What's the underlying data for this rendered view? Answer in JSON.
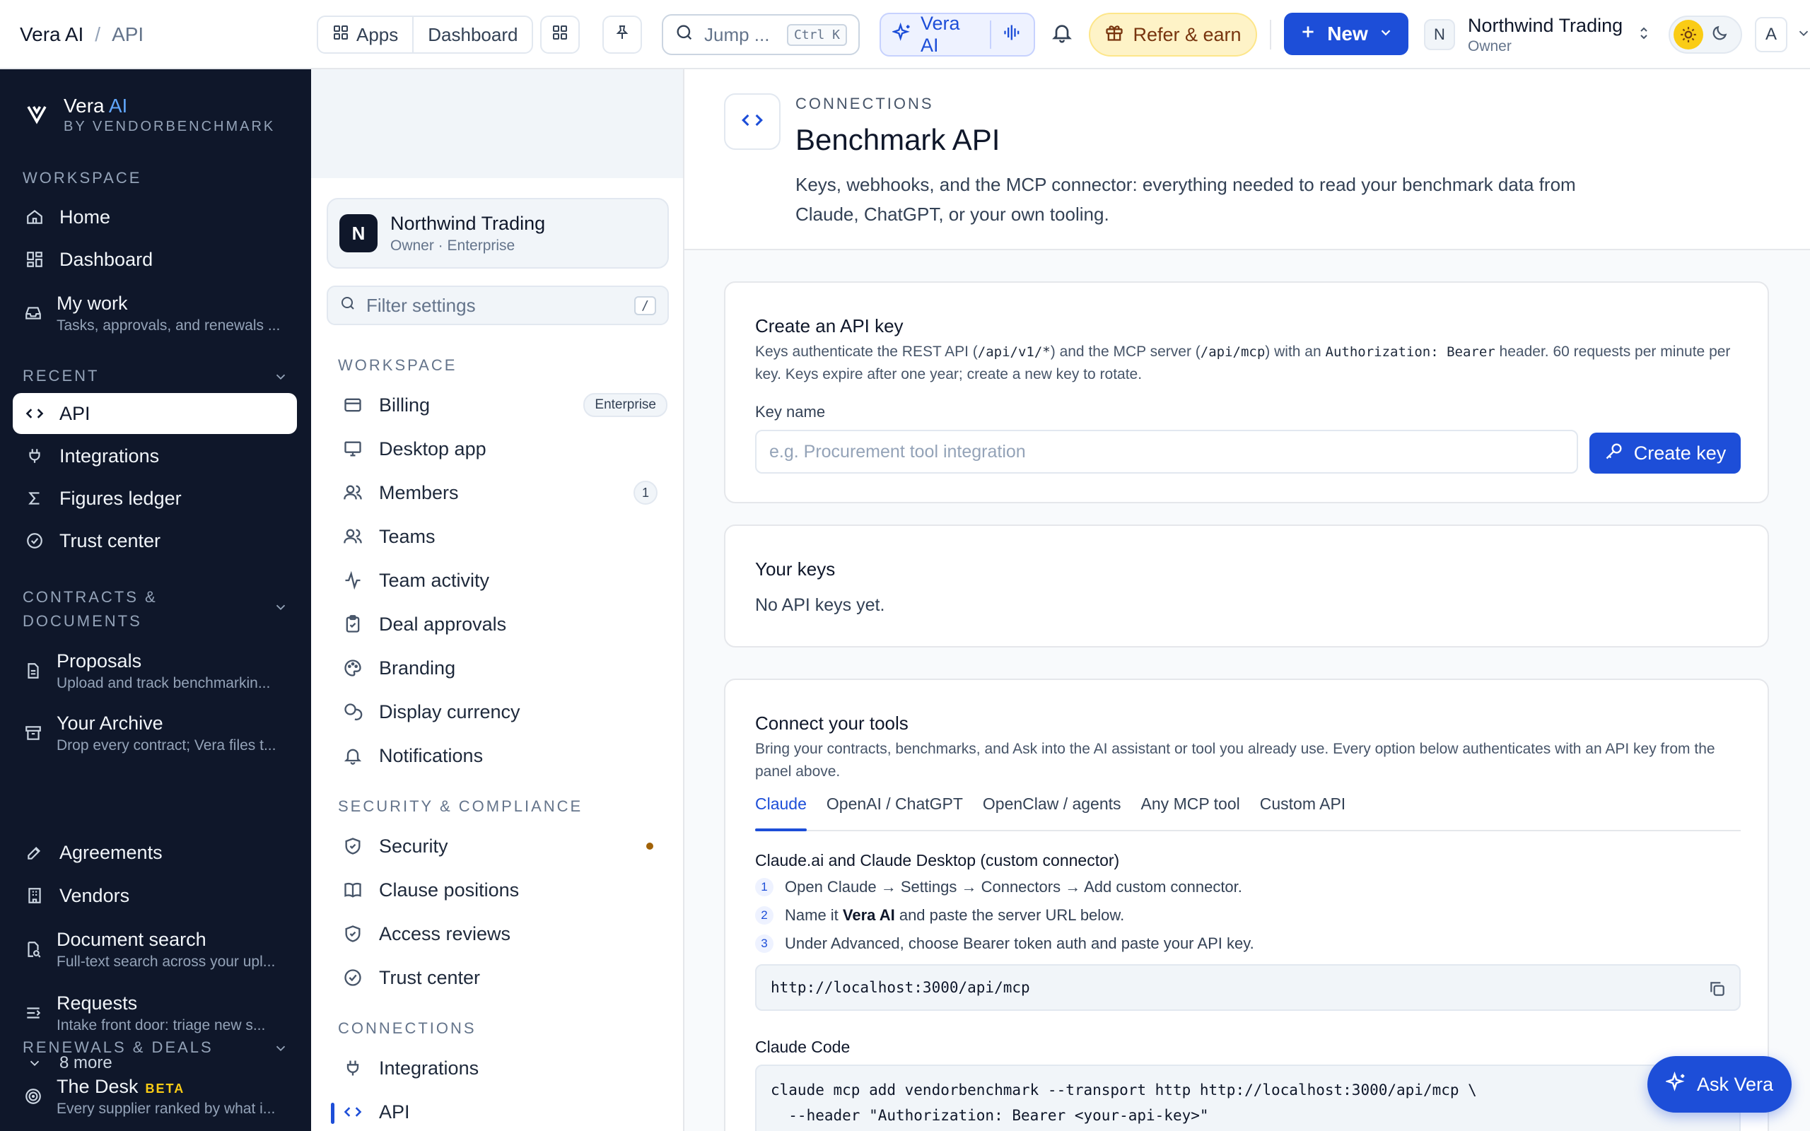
{
  "topbar": {
    "breadcrumb_root": "Vera AI",
    "breadcrumb_sep": "/",
    "breadcrumb_current": "API",
    "apps_label": "Apps",
    "dashboard_label": "Dashboard",
    "search_placeholder": "Jump ...",
    "search_shortcut": "Ctrl K",
    "vera_label": "Vera AI",
    "refer_label": "Refer & earn",
    "new_label": "New",
    "org_initial": "N",
    "org_name": "Northwind Trading",
    "org_role": "Owner",
    "user_initial": "A"
  },
  "sidebar": {
    "brand_name": "Vera",
    "brand_suffix": "AI",
    "brand_by": "BY VENDORBENCHMARK",
    "workspace_label": "WORKSPACE",
    "workspace_items": [
      {
        "label": "Home"
      },
      {
        "label": "Dashboard"
      },
      {
        "label": "My work",
        "sub": "Tasks, approvals, and renewals ..."
      }
    ],
    "recent_label": "RECENT",
    "recent_items": [
      {
        "label": "API"
      },
      {
        "label": "Integrations"
      },
      {
        "label": "Figures ledger"
      },
      {
        "label": "Trust center"
      }
    ],
    "contracts_label_1": "CONTRACTS &",
    "contracts_label_2": "DOCUMENTS",
    "contracts_items": [
      {
        "label": "Proposals",
        "sub": "Upload and track benchmarkin..."
      },
      {
        "label": "Your Archive",
        "sub": "Drop every contract; Vera files t..."
      },
      {
        "label": "Agreements"
      },
      {
        "label": "Vendors"
      },
      {
        "label": "Document search",
        "sub": "Full-text search across your upl..."
      },
      {
        "label": "Requests",
        "sub": "Intake front door: triage new s..."
      }
    ],
    "more_label": "8 more",
    "renewals_label": "RENEWALS & DEALS",
    "desk_label": "The Desk",
    "desk_badge": "BETA",
    "desk_sub": "Every supplier ranked by what i..."
  },
  "settings": {
    "org_initial": "N",
    "org_name": "Northwind Trading",
    "org_meta": "Owner · Enterprise",
    "filter_placeholder": "Filter settings",
    "filter_shortcut": "/",
    "workspace_label": "WORKSPACE",
    "workspace_items": [
      {
        "label": "Billing",
        "badge": "Enterprise"
      },
      {
        "label": "Desktop app"
      },
      {
        "label": "Members",
        "count": "1"
      },
      {
        "label": "Teams"
      },
      {
        "label": "Team activity"
      },
      {
        "label": "Deal approvals"
      },
      {
        "label": "Branding"
      },
      {
        "label": "Display currency"
      },
      {
        "label": "Notifications"
      }
    ],
    "security_label": "SECURITY & COMPLIANCE",
    "security_items": [
      {
        "label": "Security"
      },
      {
        "label": "Clause positions"
      },
      {
        "label": "Access reviews"
      },
      {
        "label": "Trust center"
      }
    ],
    "connections_label": "CONNECTIONS",
    "connections_items": [
      {
        "label": "Integrations"
      },
      {
        "label": "API"
      }
    ]
  },
  "main": {
    "eyebrow": "CONNECTIONS",
    "title": "Benchmark API",
    "description": "Keys, webhooks, and the MCP connector: everything needed to read your benchmark data from Claude, ChatGPT, or your own tooling.",
    "create_key": {
      "title": "Create an API key",
      "desc_1": "Keys authenticate the REST API (",
      "desc_code_1": "/api/v1/*",
      "desc_2": ") and the MCP server (",
      "desc_code_2": "/api/mcp",
      "desc_3": ") with an ",
      "desc_code_3": "Authorization: Bearer",
      "desc_4": " header. 60 requests per minute per key. Keys expire after one year; create a new key to rotate.",
      "key_name_label": "Key name",
      "key_name_placeholder": "e.g. Procurement tool integration",
      "button_label": "Create key"
    },
    "your_keys": {
      "title": "Your keys",
      "empty": "No API keys yet."
    },
    "connect": {
      "title": "Connect your tools",
      "desc": "Bring your contracts, benchmarks, and Ask into the AI assistant or tool you already use. Every option below authenticates with an API key from the panel above.",
      "tabs": [
        "Claude",
        "OpenAI / ChatGPT",
        "OpenClaw / agents",
        "Any MCP tool",
        "Custom API"
      ],
      "section_title": "Claude.ai and Claude Desktop (custom connector)",
      "steps": [
        {
          "num": "1",
          "text": "Open Claude → Settings → Connectors → Add custom connector."
        },
        {
          "num": "2",
          "pre": "Name it ",
          "bold": "Vera AI",
          "post": " and paste the server URL below."
        },
        {
          "num": "3",
          "text": "Under Advanced, choose Bearer token auth and paste your API key."
        }
      ],
      "server_url": "http://localhost:3000/api/mcp",
      "code_title": "Claude Code",
      "code_line_1": "claude mcp add vendorbenchmark --transport http http://localhost:3000/api/mcp \\",
      "code_line_2": "  --header \"Authorization: Bearer <your-api-key>\""
    },
    "ask_vera_label": "Ask Vera"
  },
  "colors": {
    "accent": "#1d4ed8",
    "sidebar_bg": "#0f172a",
    "refer_bg": "#fef3c7",
    "security_dot": "#a16207"
  },
  "icons": [
    "grid-icon",
    "pin-icon",
    "search-icon",
    "sparkle-icon",
    "waveform-icon",
    "bell-icon",
    "gift-icon",
    "plus-icon",
    "chevron-down-icon",
    "updown-icon",
    "sun-icon",
    "moon-icon",
    "home-icon",
    "dashboard-icon",
    "inbox-icon",
    "code-icon",
    "plug-icon",
    "sigma-icon",
    "check-circle-icon",
    "file-icon",
    "archive-icon",
    "edit-icon",
    "building-icon",
    "doc-search-icon",
    "intake-icon",
    "target-icon",
    "card-icon",
    "monitor-icon",
    "users-icon",
    "activity-icon",
    "clipboard-icon",
    "palette-icon",
    "currency-icon",
    "shield-icon",
    "book-icon",
    "key-icon",
    "copy-icon"
  ]
}
